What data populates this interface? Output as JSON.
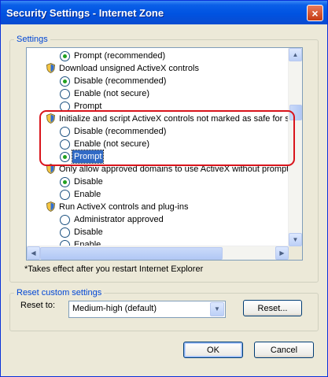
{
  "window": {
    "title": "Security Settings - Internet Zone",
    "close_glyph": "×"
  },
  "settings": {
    "legend": "Settings",
    "rows": [
      {
        "type": "radio",
        "label": "Prompt (recommended)",
        "checked": true
      },
      {
        "type": "header",
        "label": "Download unsigned ActiveX controls",
        "icon": "settings-shield-icon"
      },
      {
        "type": "radio",
        "label": "Disable (recommended)",
        "checked": true
      },
      {
        "type": "radio",
        "label": "Enable (not secure)",
        "checked": false
      },
      {
        "type": "radio",
        "label": "Prompt",
        "checked": false
      },
      {
        "type": "header",
        "label": "Initialize and script ActiveX controls not marked as safe for sc",
        "icon": "settings-shield-icon"
      },
      {
        "type": "radio",
        "label": "Disable (recommended)",
        "checked": false
      },
      {
        "type": "radio",
        "label": "Enable (not secure)",
        "checked": false
      },
      {
        "type": "radio",
        "label": "Prompt",
        "checked": true,
        "selected": true
      },
      {
        "type": "header",
        "label": "Only allow approved domains to use ActiveX without prompt",
        "icon": "settings-shield-icon"
      },
      {
        "type": "radio",
        "label": "Disable",
        "checked": true
      },
      {
        "type": "radio",
        "label": "Enable",
        "checked": false
      },
      {
        "type": "header",
        "label": "Run ActiveX controls and plug-ins",
        "icon": "settings-shield-icon"
      },
      {
        "type": "radio",
        "label": "Administrator approved",
        "checked": false
      },
      {
        "type": "radio",
        "label": "Disable",
        "checked": false
      },
      {
        "type": "radio",
        "label": "Enable",
        "checked": false
      }
    ],
    "note": "*Takes effect after you restart Internet Explorer",
    "scroll_up_glyph": "▲",
    "scroll_down_glyph": "▼",
    "scroll_left_glyph": "◀",
    "scroll_right_glyph": "▶"
  },
  "reset": {
    "legend": "Reset custom settings",
    "reset_to_label": "Reset to:",
    "combo_value": "Medium-high (default)",
    "combo_arrow": "▼",
    "reset_button": "Reset..."
  },
  "buttons": {
    "ok": "OK",
    "cancel": "Cancel"
  },
  "colors": {
    "title_blue": "#0053e1",
    "highlight_red": "#d9141c",
    "legend_blue": "#0046d5",
    "radio_green": "#21a121"
  }
}
